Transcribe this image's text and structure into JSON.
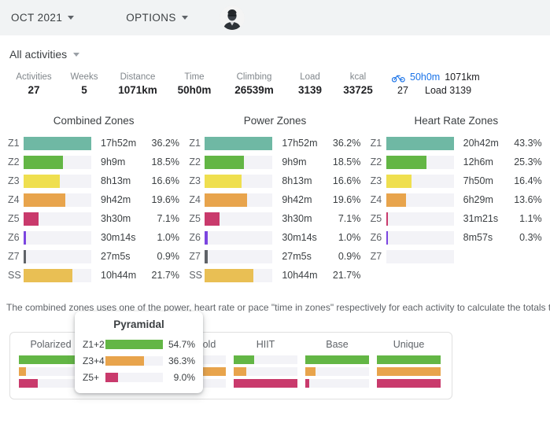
{
  "appbar": {
    "period_label": "OCT 2021",
    "options_label": "OPTIONS",
    "avatar_name": "user-avatar"
  },
  "subheader": {
    "activity_filter_label": "All activities"
  },
  "stats": [
    {
      "key": "Activities",
      "value": "27"
    },
    {
      "key": "Weeks",
      "value": "5"
    },
    {
      "key": "Distance",
      "value": "1071km"
    },
    {
      "key": "Time",
      "value": "50h0m"
    },
    {
      "key": "Climbing",
      "value": "26539m"
    },
    {
      "key": "Load",
      "value": "3139"
    },
    {
      "key": "kcal",
      "value": "33725"
    }
  ],
  "sport_summary": {
    "icon": "bicycle-icon",
    "time": "50h0m",
    "distance": "1071km",
    "count": "27",
    "load": "Load 3139",
    "link_color": "#1a73e8"
  },
  "zone_colors": {
    "z1": "#6fb8a4",
    "z2": "#63b645",
    "z3": "#efdf4f",
    "z4": "#e8a council",
    "z5": "#c93a6c",
    "z6": "#7b45e0",
    "z7": "#5f6368",
    "ss": "#e9bf54",
    "track": "#f3f3f7"
  },
  "zone_colors_fixed": {
    "z1": "#6fb8a4",
    "z2": "#63b645",
    "z3": "#efdf4f",
    "z4": "#e8a44c",
    "z5": "#c93a6c",
    "z6": "#7b45e0",
    "z7": "#5f6368",
    "ss": "#e9bf54"
  },
  "chart_data": [
    {
      "type": "bar",
      "title": "Combined Zones",
      "orientation": "horizontal",
      "categories": [
        "Z1",
        "Z2",
        "Z3",
        "Z4",
        "Z5",
        "Z6",
        "Z7",
        "SS"
      ],
      "values": [
        36.2,
        18.5,
        16.6,
        19.6,
        7.1,
        1.0,
        0.9,
        21.7
      ],
      "value_labels": [
        "36.2%",
        "18.5%",
        "16.6%",
        "19.6%",
        "7.1%",
        "1.0%",
        "0.9%",
        "21.7%"
      ],
      "time_labels": [
        "17h52m",
        "9h9m",
        "8h13m",
        "9h42m",
        "3h30m",
        "30m14s",
        "27m5s",
        "10h44m"
      ],
      "bar_widths_pct": [
        100,
        58,
        54,
        62,
        22,
        4,
        4,
        72
      ],
      "colors": [
        "#6fb8a4",
        "#63b645",
        "#efdf4f",
        "#e8a44c",
        "#c93a6c",
        "#7b45e0",
        "#5f6368",
        "#e9bf54"
      ],
      "xlabel": "",
      "ylabel": "",
      "grid": false,
      "legend": "none"
    },
    {
      "type": "bar",
      "title": "Power Zones",
      "orientation": "horizontal",
      "categories": [
        "Z1",
        "Z2",
        "Z3",
        "Z4",
        "Z5",
        "Z6",
        "Z7",
        "SS"
      ],
      "values": [
        36.2,
        18.5,
        16.6,
        19.6,
        7.1,
        1.0,
        0.9,
        21.7
      ],
      "value_labels": [
        "36.2%",
        "18.5%",
        "16.6%",
        "19.6%",
        "7.1%",
        "1.0%",
        "0.9%",
        "21.7%"
      ],
      "time_labels": [
        "17h52m",
        "9h9m",
        "8h13m",
        "9h42m",
        "3h30m",
        "30m14s",
        "27m5s",
        "10h44m"
      ],
      "bar_widths_pct": [
        100,
        58,
        54,
        62,
        22,
        4,
        4,
        72
      ],
      "colors": [
        "#6fb8a4",
        "#63b645",
        "#efdf4f",
        "#e8a44c",
        "#c93a6c",
        "#7b45e0",
        "#5f6368",
        "#e9bf54"
      ],
      "xlabel": "",
      "ylabel": "",
      "grid": false,
      "legend": "none"
    },
    {
      "type": "bar",
      "title": "Heart Rate Zones",
      "orientation": "horizontal",
      "categories": [
        "Z1",
        "Z2",
        "Z3",
        "Z4",
        "Z5",
        "Z6",
        "Z7"
      ],
      "values": [
        43.3,
        25.3,
        16.4,
        13.6,
        1.1,
        0.3,
        0
      ],
      "value_labels": [
        "43.3%",
        "25.3%",
        "16.4%",
        "13.6%",
        "1.1%",
        "0.3%",
        ""
      ],
      "time_labels": [
        "20h42m",
        "12h6m",
        "7h50m",
        "6h29m",
        "31m21s",
        "8m57s",
        ""
      ],
      "bar_widths_pct": [
        100,
        60,
        38,
        30,
        3,
        3,
        0
      ],
      "colors": [
        "#6fb8a4",
        "#63b645",
        "#efdf4f",
        "#e8a44c",
        "#c93a6c",
        "#7b45e0",
        "#5f6368"
      ],
      "xlabel": "",
      "ylabel": "",
      "grid": false,
      "legend": "none"
    },
    {
      "type": "bar",
      "title": "Pyramidal",
      "orientation": "horizontal",
      "categories": [
        "Z1+2",
        "Z3+4",
        "Z5+"
      ],
      "values": [
        54.7,
        36.3,
        9.0
      ],
      "value_labels": [
        "54.7%",
        "36.3%",
        "9.0%"
      ],
      "bar_widths_pct": [
        100,
        67,
        22
      ],
      "colors": [
        "#63b645",
        "#e8a44c",
        "#c93a6c"
      ],
      "xlabel": "",
      "ylabel": "",
      "grid": false,
      "legend": "none"
    }
  ],
  "note": {
    "text": "The combined zones uses one of the power, heart rate or pace \"time in zones\" respectively for each activity to calculate the totals t"
  },
  "distribution": {
    "cards": [
      {
        "title": "Polarized",
        "bars": [
          {
            "zone": "Z1+2",
            "width_pct": 100,
            "color": "#63b645"
          },
          {
            "zone": "Z3+4",
            "width_pct": 11,
            "color": "#e8a44c"
          },
          {
            "zone": "Z5+",
            "width_pct": 30,
            "color": "#c93a6c"
          }
        ]
      },
      {
        "title": "Pyramidal",
        "bars": [
          {
            "zone": "Z1+2",
            "width_pct": 100,
            "color": "#63b645"
          },
          {
            "zone": "Z3+4",
            "width_pct": 67,
            "color": "#e8a44c"
          },
          {
            "zone": "Z5+",
            "width_pct": 22,
            "color": "#c93a6c"
          }
        ]
      },
      {
        "title": "Threshold",
        "bars": [
          {
            "zone": "Z1+2",
            "width_pct": 62,
            "color": "#63b645"
          },
          {
            "zone": "Z3+4",
            "width_pct": 100,
            "color": "#e8a44c"
          },
          {
            "zone": "Z5+",
            "width_pct": 24,
            "color": "#c93a6c"
          }
        ]
      },
      {
        "title": "HIIT",
        "bars": [
          {
            "zone": "Z1+2",
            "width_pct": 32,
            "color": "#63b645"
          },
          {
            "zone": "Z3+4",
            "width_pct": 20,
            "color": "#e8a44c"
          },
          {
            "zone": "Z5+",
            "width_pct": 100,
            "color": "#c93a6c"
          }
        ]
      },
      {
        "title": "Base",
        "bars": [
          {
            "zone": "Z1+2",
            "width_pct": 100,
            "color": "#63b645"
          },
          {
            "zone": "Z3+4",
            "width_pct": 16,
            "color": "#e8a44c"
          },
          {
            "zone": "Z5+",
            "width_pct": 6,
            "color": "#c93a6c"
          }
        ]
      },
      {
        "title": "Unique",
        "bars": [
          {
            "zone": "Z1+2",
            "width_pct": 100,
            "color": "#63b645"
          },
          {
            "zone": "Z3+4",
            "width_pct": 100,
            "color": "#e8a44c"
          },
          {
            "zone": "Z5+",
            "width_pct": 100,
            "color": "#c93a6c"
          }
        ]
      }
    ],
    "visible_cards": [
      "Polarized",
      "Threshold",
      "HIIT",
      "Base",
      "Unique"
    ]
  },
  "tooltip": {
    "title": "Pyramidal",
    "rows": [
      {
        "label": "Z1+2",
        "pct": "54.7%",
        "width_pct": 100,
        "color": "#63b645"
      },
      {
        "label": "Z3+4",
        "pct": "36.3%",
        "width_pct": 67,
        "color": "#e8a44c"
      },
      {
        "label": "Z5+",
        "pct": "9.0%",
        "width_pct": 22,
        "color": "#c93a6c"
      }
    ]
  }
}
